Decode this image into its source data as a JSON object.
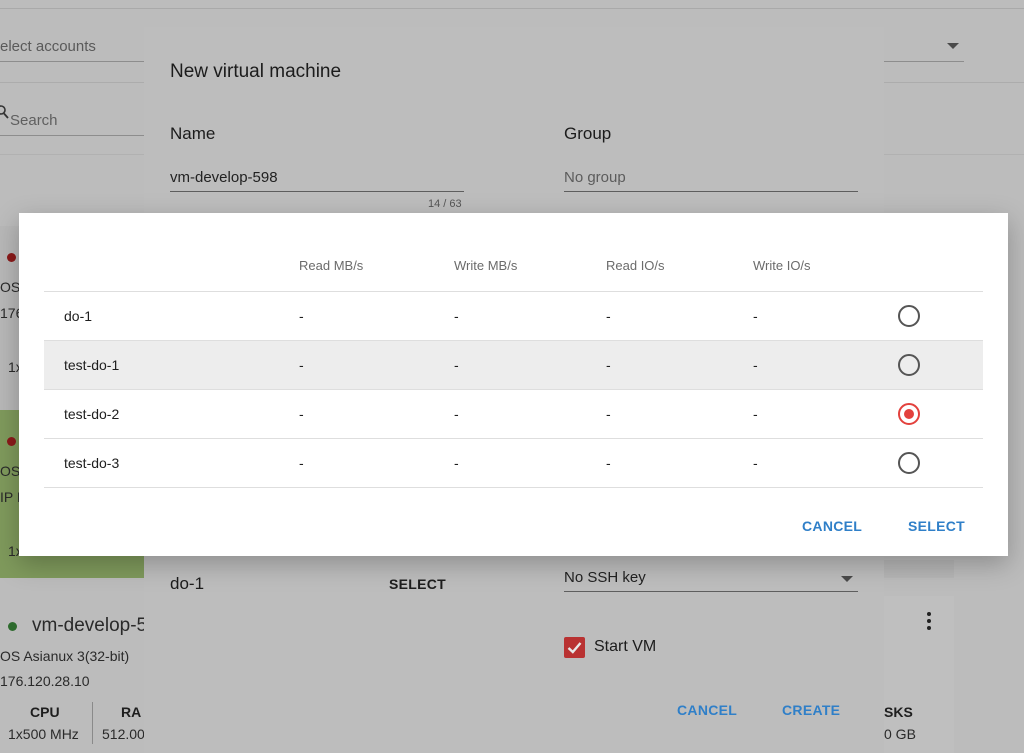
{
  "background": {
    "accounts_placeholder": "elect accounts",
    "search_placeholder": "Search",
    "card1": {
      "line1": "OS",
      "line2": "176",
      "line3": "1x"
    },
    "card2": {
      "line1": "OS",
      "line2": "IP I",
      "line3": "1x"
    },
    "vm_card": {
      "name": "vm-develop-5",
      "os": "OS Asianux 3(32-bit)",
      "ip": "176.120.28.10",
      "cpu_label": "CPU",
      "cpu_value": "1x500 MHz",
      "ram_label": "RA",
      "ram_value": "512.00",
      "disks_label": "SKS",
      "disks_value": "0 GB"
    },
    "status_colors": {
      "stopped": "#8b1a1a",
      "running": "#2e6b2e"
    }
  },
  "vm_dialog": {
    "title": "New virtual machine",
    "name_label": "Name",
    "name_value": "vm-develop-598",
    "name_counter": "14 / 63",
    "group_label": "Group",
    "group_placeholder": "No group",
    "disk_offering_value": "do-1",
    "disk_select_label": "SELECT",
    "ssh_key_value": "No SSH key",
    "start_vm_label": "Start VM",
    "start_vm_checked": true,
    "cancel_label": "CANCEL",
    "create_label": "CREATE"
  },
  "selector_modal": {
    "columns": [
      "",
      "Read MB/s",
      "Write MB/s",
      "Read IO/s",
      "Write IO/s"
    ],
    "rows": [
      {
        "name": "do-1",
        "read_mbs": "-",
        "write_mbs": "-",
        "read_ios": "-",
        "write_ios": "-",
        "selected": false
      },
      {
        "name": "test-do-1",
        "read_mbs": "-",
        "write_mbs": "-",
        "read_ios": "-",
        "write_ios": "-",
        "selected": false
      },
      {
        "name": "test-do-2",
        "read_mbs": "-",
        "write_mbs": "-",
        "read_ios": "-",
        "write_ios": "-",
        "selected": true
      },
      {
        "name": "test-do-3",
        "read_mbs": "-",
        "write_mbs": "-",
        "read_ios": "-",
        "write_ios": "-",
        "selected": false
      }
    ],
    "cancel_label": "CANCEL",
    "select_label": "SELECT",
    "accent_color": "#2f7fc8",
    "radio_selected_color": "#e3413d"
  }
}
